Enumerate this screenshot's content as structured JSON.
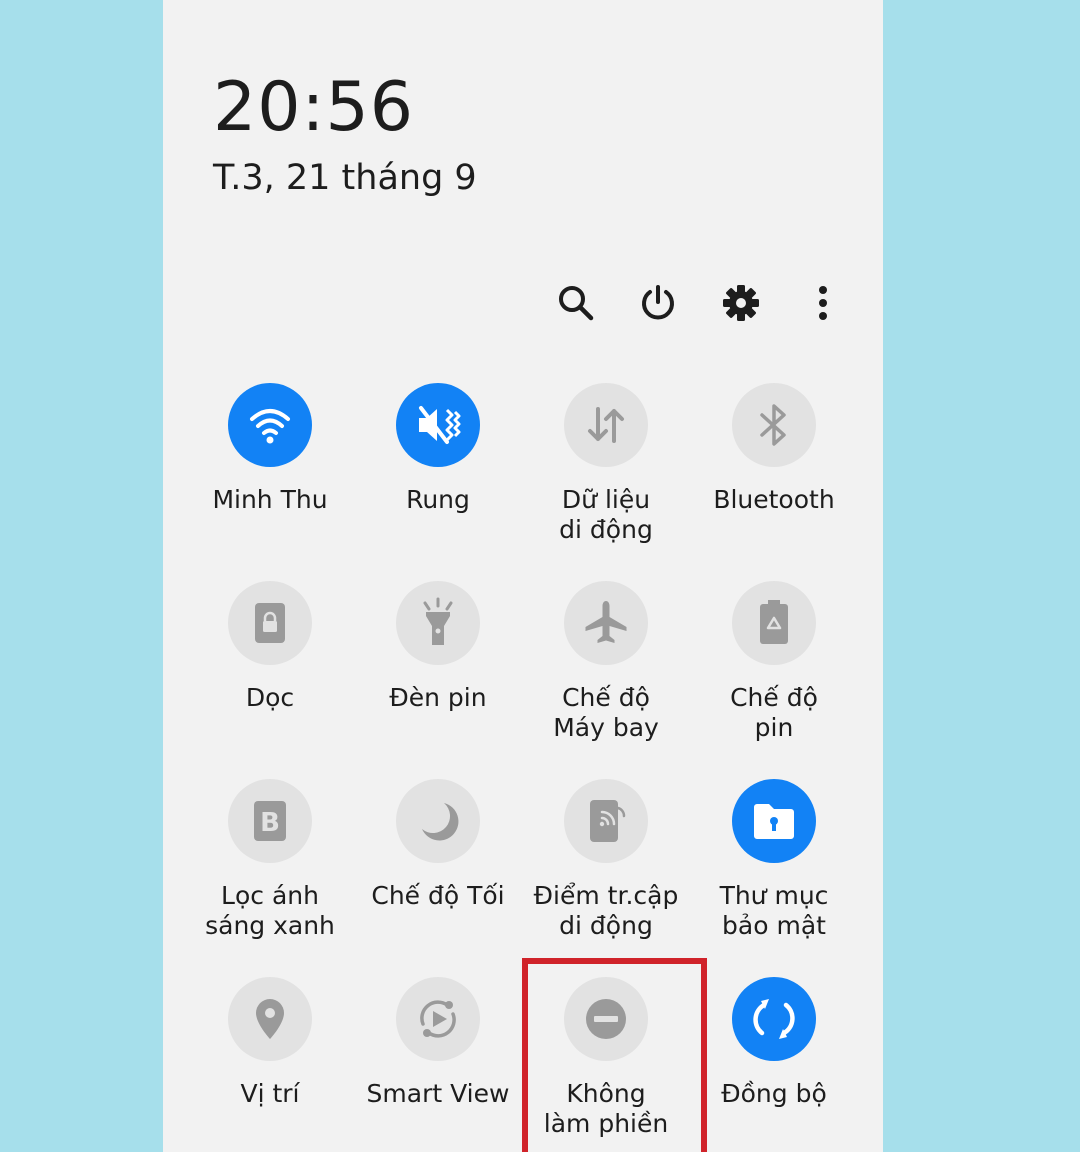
{
  "status": {
    "time": "20:56",
    "date": "T.3, 21 tháng 9"
  },
  "toolbar": {
    "icons": [
      "search-icon",
      "power-icon",
      "settings-gear-icon",
      "more-vert-icon"
    ]
  },
  "tiles": [
    {
      "line1": "Minh Thu",
      "line2": "",
      "on": true,
      "icon": "wifi-icon"
    },
    {
      "line1": "Rung",
      "line2": "",
      "on": true,
      "icon": "vibrate-icon"
    },
    {
      "line1": "Dữ liệu",
      "line2": "di động",
      "on": false,
      "icon": "mobile-data-icon"
    },
    {
      "line1": "Bluetooth",
      "line2": "",
      "on": false,
      "icon": "bluetooth-icon"
    },
    {
      "line1": "Dọc",
      "line2": "",
      "on": false,
      "icon": "portrait-lock-icon"
    },
    {
      "line1": "Đèn pin",
      "line2": "",
      "on": false,
      "icon": "flashlight-icon"
    },
    {
      "line1": "Chế độ",
      "line2": "Máy bay",
      "on": false,
      "icon": "airplane-icon"
    },
    {
      "line1": "Chế độ",
      "line2": "pin",
      "on": false,
      "icon": "battery-saver-icon"
    },
    {
      "line1": "Lọc ánh",
      "line2": "sáng xanh",
      "on": false,
      "icon": "blue-light-filter-icon"
    },
    {
      "line1": "Chế độ Tối",
      "line2": "",
      "on": false,
      "icon": "moon-icon"
    },
    {
      "line1": "Điểm tr.cập",
      "line2": "di động",
      "on": false,
      "icon": "hotspot-icon"
    },
    {
      "line1": "Thư mục",
      "line2": "bảo mật",
      "on": true,
      "icon": "secure-folder-icon"
    },
    {
      "line1": "Vị trí",
      "line2": "",
      "on": false,
      "icon": "location-pin-icon"
    },
    {
      "line1": "Smart View",
      "line2": "",
      "on": false,
      "icon": "smart-view-icon"
    },
    {
      "line1": "Không",
      "line2": "làm phiền",
      "on": false,
      "icon": "do-not-disturb-icon"
    },
    {
      "line1": "Đồng bộ",
      "line2": "",
      "on": true,
      "icon": "sync-icon"
    }
  ],
  "colors": {
    "accent": "#1282f5",
    "tile_off": "#e2e2e2",
    "icon_off": "#9a9a9a",
    "highlight": "#d0232a",
    "backdrop": "#a6dfeb"
  }
}
